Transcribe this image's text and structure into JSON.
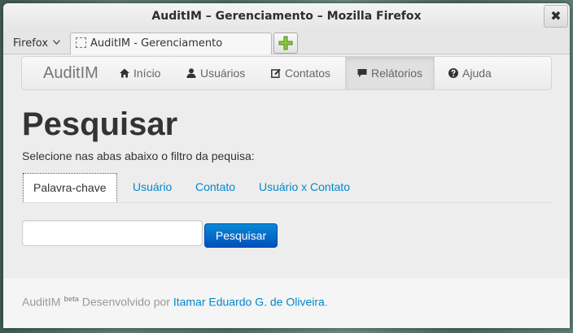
{
  "window": {
    "title": "AuditIM – Gerenciamento – Mozilla Firefox",
    "close_glyph": "✖"
  },
  "browser": {
    "menu_label": "Firefox",
    "tab_title": "AuditIM - Gerenciamento"
  },
  "navbar": {
    "brand": "AuditIM",
    "items": [
      {
        "label": "Início",
        "icon": "home-icon"
      },
      {
        "label": "Usuários",
        "icon": "user-icon"
      },
      {
        "label": "Contatos",
        "icon": "edit-icon"
      },
      {
        "label": "Relátorios",
        "icon": "comment-icon",
        "active": true
      },
      {
        "label": "Ajuda",
        "icon": "question-icon"
      }
    ]
  },
  "main": {
    "title": "Pesquisar",
    "subtitle": "Selecione nas abas abaixo o filtro da pequisa:",
    "tabs": [
      {
        "label": "Palavra-chave",
        "active": true
      },
      {
        "label": "Usuário"
      },
      {
        "label": "Contato"
      },
      {
        "label": "Usuário x Contato"
      }
    ],
    "search_value": "",
    "search_button": "Pesquisar"
  },
  "footer": {
    "app_name": "AuditIM",
    "badge": "beta",
    "text": "Desenvolvido por",
    "author": "Itamar Eduardo G. de Oliveira",
    "period": "."
  },
  "colors": {
    "link": "#0088cc",
    "primary_button": "#0064cd"
  }
}
